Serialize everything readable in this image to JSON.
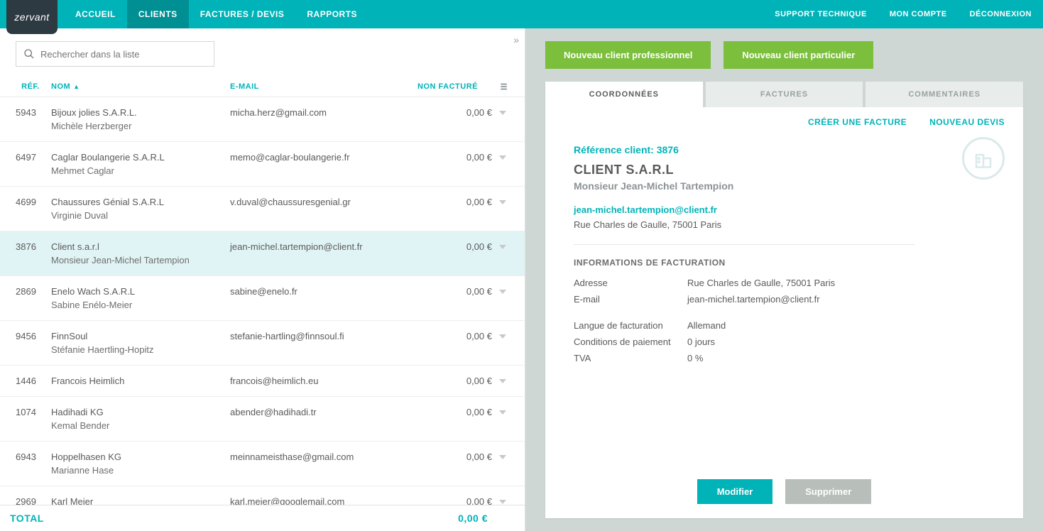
{
  "brand": "zervant",
  "nav": {
    "accueil": "ACCUEIL",
    "clients": "CLIENTS",
    "factures": "FACTURES / DEVIS",
    "rapports": "RAPPORTS",
    "support": "SUPPORT TECHNIQUE",
    "compte": "MON COMPTE",
    "deconnexion": "DÉCONNEXION"
  },
  "search": {
    "placeholder": "Rechercher dans la liste"
  },
  "list": {
    "headers": {
      "ref": "RÉF.",
      "nom": "NOM",
      "email": "E-MAIL",
      "non_facture": "NON FACTURÉ"
    },
    "rows": [
      {
        "ref": "5943",
        "name": "Bijoux jolies S.A.R.L.",
        "sub": "Michèle Herzberger",
        "email": "micha.herz@gmail.com",
        "amount": "0,00 €"
      },
      {
        "ref": "6497",
        "name": "Caglar Boulangerie S.A.R.L",
        "sub": "Mehmet Caglar",
        "email": "memo@caglar-boulangerie.fr",
        "amount": "0,00 €"
      },
      {
        "ref": "4699",
        "name": "Chaussures Génial S.A.R.L",
        "sub": "Virginie Duval",
        "email": "v.duval@chaussuresgenial.gr",
        "amount": "0,00 €"
      },
      {
        "ref": "3876",
        "name": "Client s.a.r.l",
        "sub": "Monsieur Jean-Michel Tartempion",
        "email": "jean-michel.tartempion@client.fr",
        "amount": "0,00 €"
      },
      {
        "ref": "2869",
        "name": "Enelo Wach S.A.R.L",
        "sub": "Sabine Enélo-Meier",
        "email": "sabine@enelo.fr",
        "amount": "0,00 €"
      },
      {
        "ref": "9456",
        "name": "FinnSoul",
        "sub": "Stéfanie Haertling-Hopitz",
        "email": "stefanie-hartling@finnsoul.fi",
        "amount": "0,00 €"
      },
      {
        "ref": "1446",
        "name": "Francois Heimlich",
        "sub": "",
        "email": "francois@heimlich.eu",
        "amount": "0,00 €"
      },
      {
        "ref": "1074",
        "name": "Hadihadi KG",
        "sub": "Kemal Bender",
        "email": "abender@hadihadi.tr",
        "amount": "0,00 €"
      },
      {
        "ref": "6943",
        "name": "Hoppelhasen KG",
        "sub": "Marianne Hase",
        "email": "meinnameisthase@gmail.com",
        "amount": "0,00 €"
      },
      {
        "ref": "2969",
        "name": "Karl Meier",
        "sub": "",
        "email": "karl.meier@googlemail.com",
        "amount": "0,00 €"
      }
    ],
    "total_label": "TOTAL",
    "total_value": "0,00 €",
    "selected_index": 3
  },
  "right": {
    "new_pro": "Nouveau client professionnel",
    "new_part": "Nouveau client particulier",
    "tabs": {
      "coord": "COORDONNÉES",
      "factures": "FACTURES",
      "comm": "COMMENTAIRES"
    },
    "actions": {
      "creer_facture": "CRÉER UNE FACTURE",
      "nouveau_devis": "NOUVEAU DEVIS"
    },
    "ref_label": "Référence client: 3876",
    "client_name": "CLIENT S.A.R.L",
    "contact_name": "Monsieur Jean-Michel Tartempion",
    "email": "jean-michel.tartempion@client.fr",
    "address": "Rue Charles de Gaulle, 75001 Paris",
    "section_title": "INFORMATIONS DE FACTURATION",
    "billing": {
      "adresse_label": "Adresse",
      "adresse_val": "Rue Charles de Gaulle, 75001 Paris",
      "email_label": "E-mail",
      "email_val": "jean-michel.tartempion@client.fr",
      "langue_label": "Langue de facturation",
      "langue_val": "Allemand",
      "cond_label": "Conditions de paiement",
      "cond_val": "0 jours",
      "tva_label": "TVA",
      "tva_val": "0 %"
    },
    "modifier": "Modifier",
    "supprimer": "Supprimer"
  }
}
